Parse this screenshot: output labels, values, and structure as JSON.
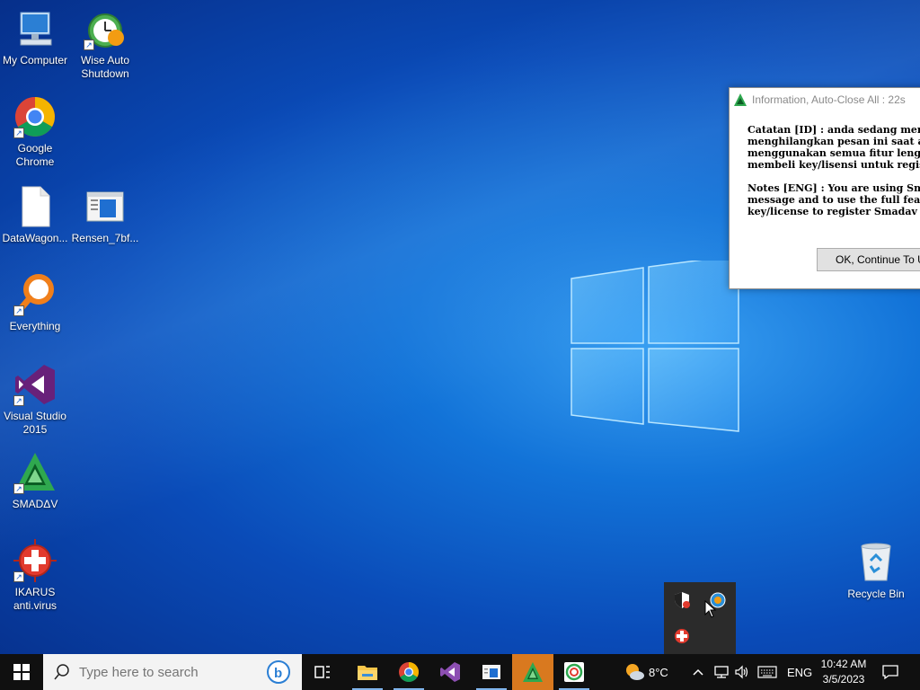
{
  "desktop": {
    "icons": [
      {
        "label": "My Computer"
      },
      {
        "label": "Wise Auto Shutdown"
      },
      {
        "label": "Google Chrome"
      },
      {
        "label": "DataWagon..."
      },
      {
        "label": "Rensen_7bf..."
      },
      {
        "label": "Everything"
      },
      {
        "label": "Visual Studio 2015"
      },
      {
        "label": "SMADΔV"
      },
      {
        "label": "IKARUS anti.virus"
      },
      {
        "label": "Recycle Bin"
      }
    ]
  },
  "dialog": {
    "title": "Information, Auto-Close All : 22s",
    "id_lines": [
      "Catatan [ID] : anda sedang mengg",
      "menghilangkan pesan ini saat awa",
      "menggunakan semua fitur lengkap",
      "membeli key/lisensi untuk registr"
    ],
    "eng_lines": [
      "Notes [ENG] : You are using Smada",
      "message and to use the full featur",
      "key/license to register Smadav Pr"
    ],
    "button_label": "OK, Continue To Us"
  },
  "taskbar": {
    "search_placeholder": "Type here to search",
    "weather_temp": "8°C",
    "language": "ENG",
    "time": "10:42 AM",
    "date": "3/5/2023"
  },
  "colors": {
    "taskbar_bg": "#101010",
    "active_app": "#d9791f",
    "desktop_blue": "#1273d8"
  }
}
